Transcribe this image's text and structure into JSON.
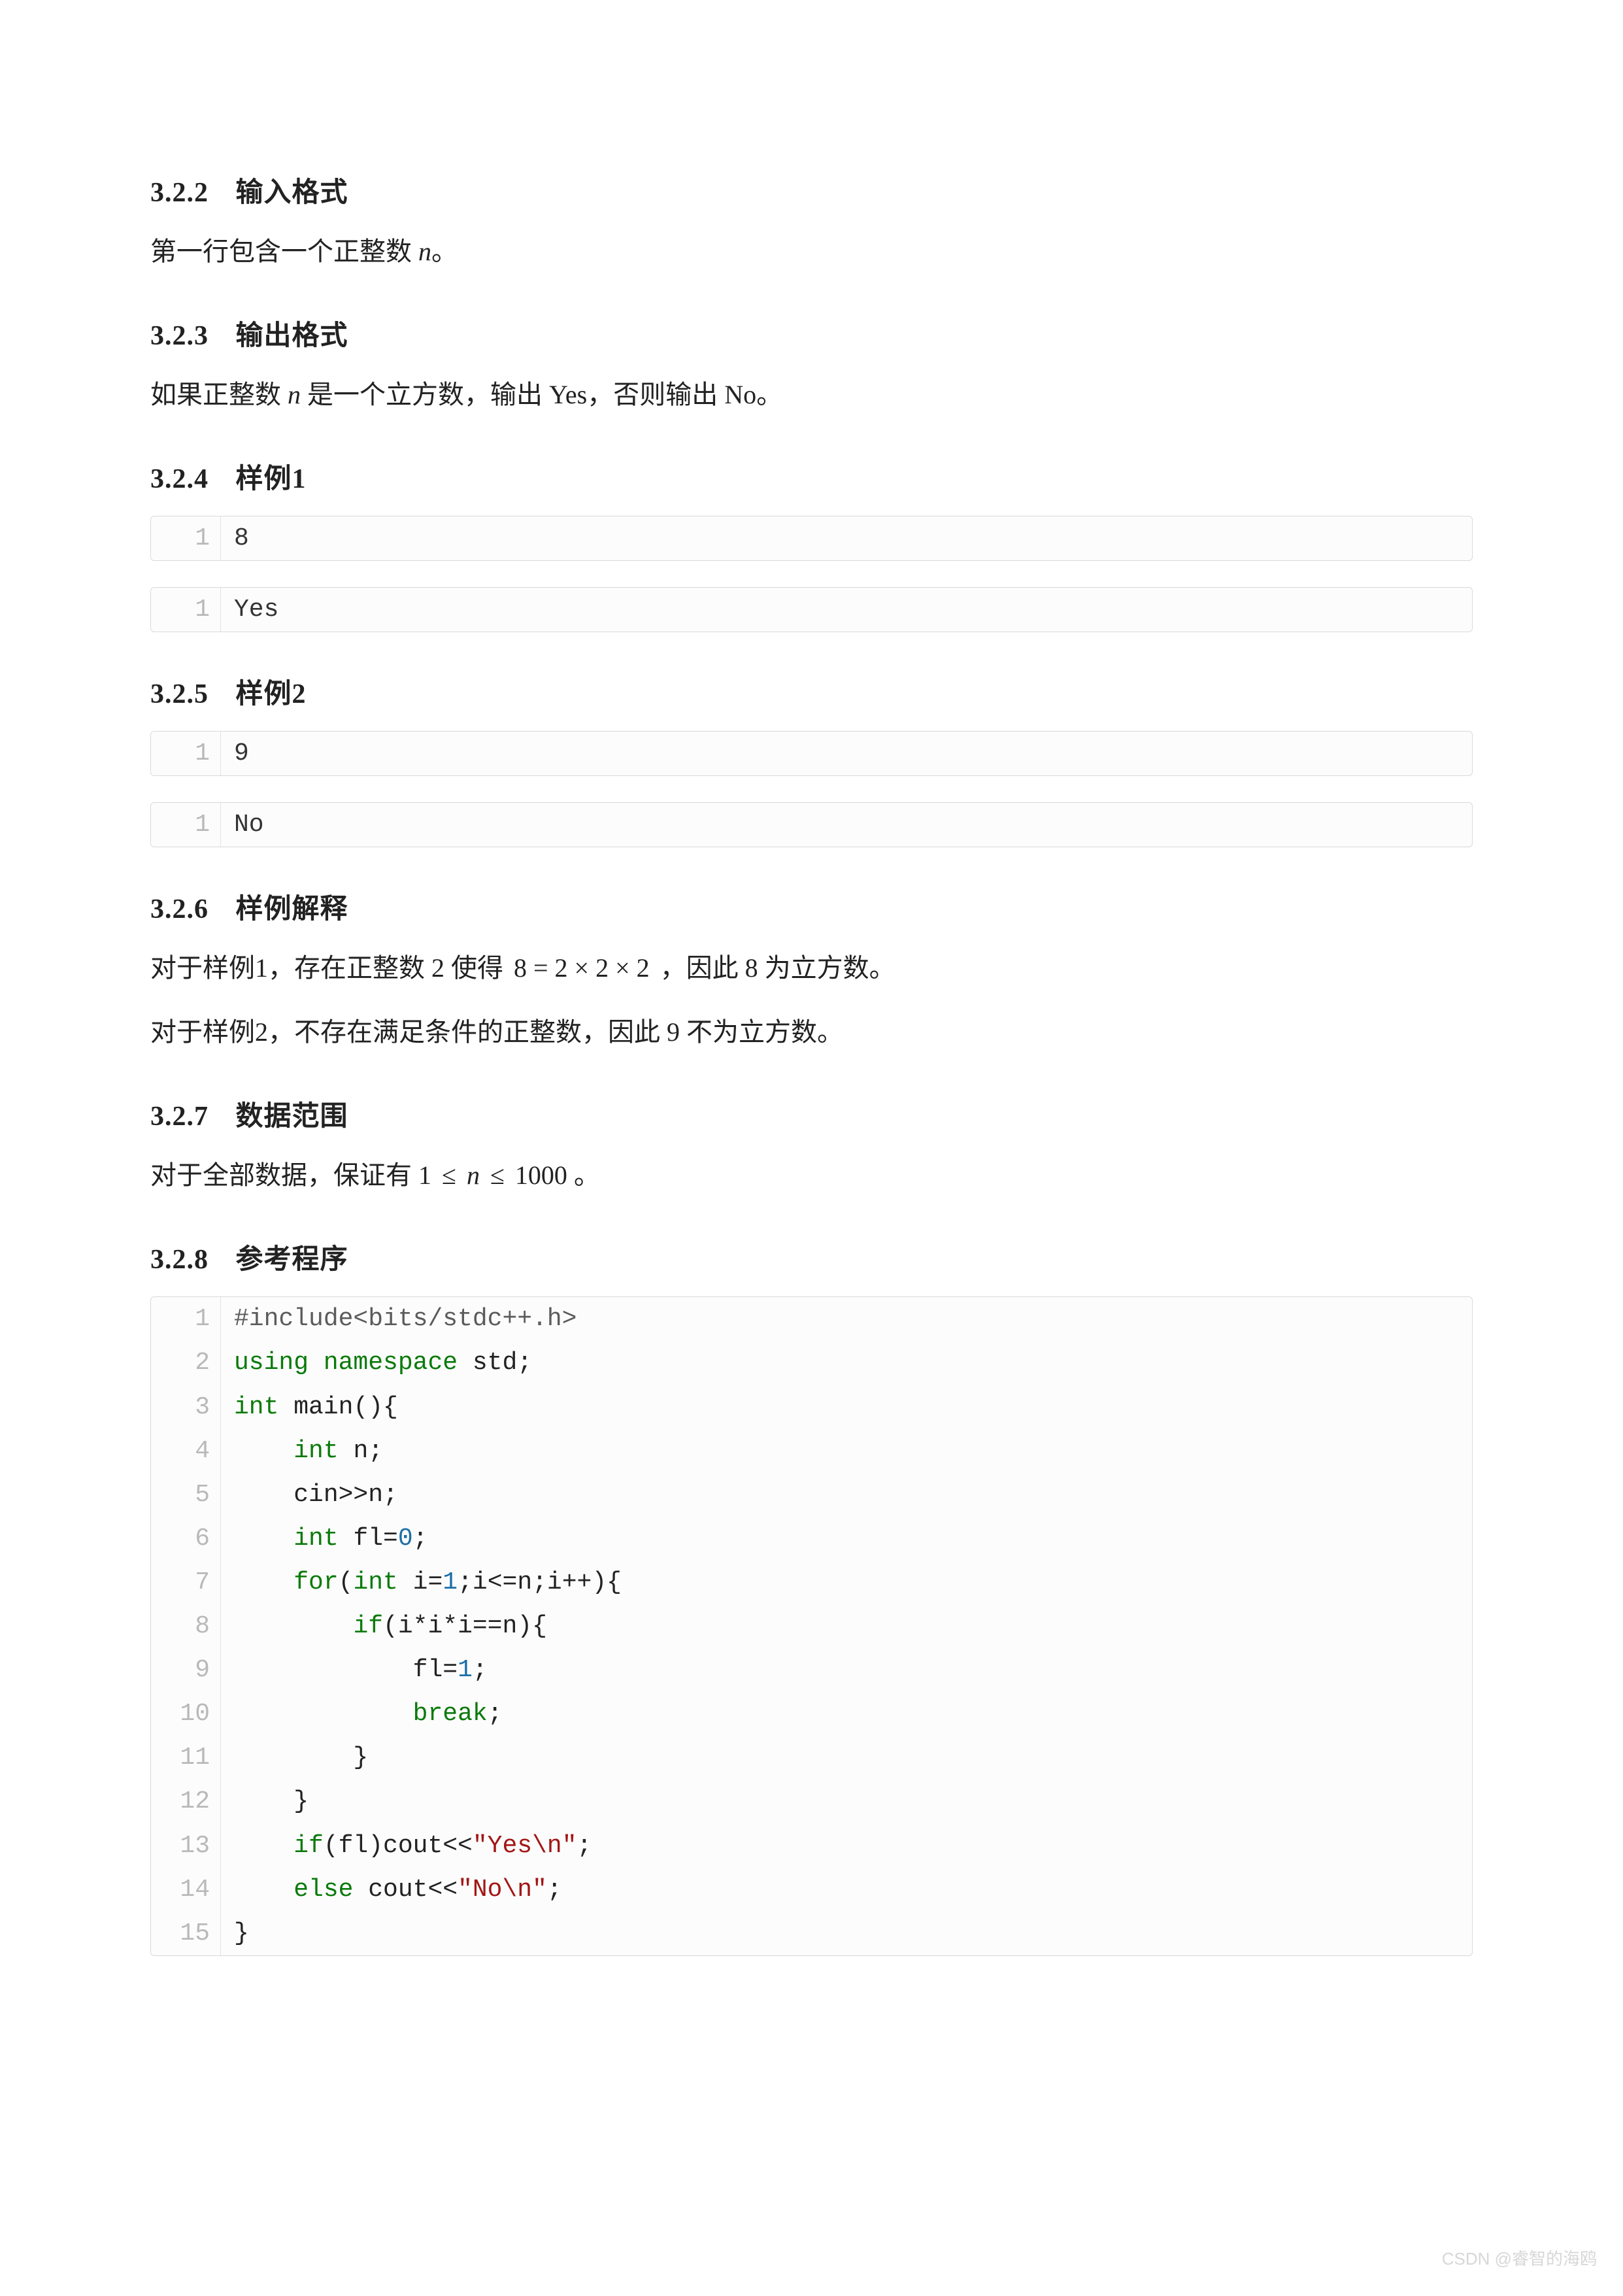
{
  "sections": {
    "s322": {
      "num": "3.2.2",
      "title": "输入格式",
      "body": "第一行包含一个正整数 n。"
    },
    "s323": {
      "num": "3.2.3",
      "title": "输出格式",
      "body": "如果正整数 n 是一个立方数，输出 Yes，否则输出 No。"
    },
    "s324": {
      "num": "3.2.4",
      "title": "样例1"
    },
    "s325": {
      "num": "3.2.5",
      "title": "样例2"
    },
    "s326": {
      "num": "3.2.6",
      "title": "样例解释",
      "line1_a": "对于样例1，存在正整数 2 使得 ",
      "line1_math": "8 = 2 × 2 × 2",
      "line1_b": "，因此 8 为立方数。",
      "line2": "对于样例2，不存在满足条件的正整数，因此 9 不为立方数。"
    },
    "s327": {
      "num": "3.2.7",
      "title": "数据范围",
      "body_a": "对于全部数据，保证有 ",
      "body_math": "1 ≤ n ≤ 1000",
      "body_b": "。"
    },
    "s328": {
      "num": "3.2.8",
      "title": "参考程序"
    }
  },
  "examples": {
    "ex1_in": [
      {
        "n": "1",
        "text": "8"
      }
    ],
    "ex1_out": [
      {
        "n": "1",
        "text": "Yes"
      }
    ],
    "ex2_in": [
      {
        "n": "1",
        "text": "9"
      }
    ],
    "ex2_out": [
      {
        "n": "1",
        "text": "No"
      }
    ]
  },
  "program": {
    "lines": [
      {
        "n": "1",
        "tokens": [
          {
            "t": "#include<bits/stdc++.h>",
            "c": "pp"
          }
        ]
      },
      {
        "n": "2",
        "tokens": [
          {
            "t": "using ",
            "c": "kw"
          },
          {
            "t": "namespace ",
            "c": "kw"
          },
          {
            "t": "std",
            "c": "id"
          },
          {
            "t": ";",
            "c": "op"
          }
        ]
      },
      {
        "n": "3",
        "tokens": [
          {
            "t": "int ",
            "c": "type"
          },
          {
            "t": "main",
            "c": "fn"
          },
          {
            "t": "(){",
            "c": "op"
          }
        ]
      },
      {
        "n": "4",
        "tokens": [
          {
            "t": "    ",
            "c": "id"
          },
          {
            "t": "int ",
            "c": "type"
          },
          {
            "t": "n",
            "c": "id"
          },
          {
            "t": ";",
            "c": "op"
          }
        ]
      },
      {
        "n": "5",
        "tokens": [
          {
            "t": "    cin>>n;",
            "c": "id"
          }
        ]
      },
      {
        "n": "6",
        "tokens": [
          {
            "t": "    ",
            "c": "id"
          },
          {
            "t": "int ",
            "c": "type"
          },
          {
            "t": "fl",
            "c": "id"
          },
          {
            "t": "=",
            "c": "op"
          },
          {
            "t": "0",
            "c": "num"
          },
          {
            "t": ";",
            "c": "op"
          }
        ]
      },
      {
        "n": "7",
        "tokens": [
          {
            "t": "    ",
            "c": "id"
          },
          {
            "t": "for",
            "c": "kw"
          },
          {
            "t": "(",
            "c": "op"
          },
          {
            "t": "int ",
            "c": "type"
          },
          {
            "t": "i",
            "c": "id"
          },
          {
            "t": "=",
            "c": "op"
          },
          {
            "t": "1",
            "c": "num"
          },
          {
            "t": ";i<=n;i++){",
            "c": "id"
          }
        ]
      },
      {
        "n": "8",
        "tokens": [
          {
            "t": "        ",
            "c": "id"
          },
          {
            "t": "if",
            "c": "kw"
          },
          {
            "t": "(i*i*i==n){",
            "c": "id"
          }
        ]
      },
      {
        "n": "9",
        "tokens": [
          {
            "t": "            fl=",
            "c": "id"
          },
          {
            "t": "1",
            "c": "num"
          },
          {
            "t": ";",
            "c": "op"
          }
        ]
      },
      {
        "n": "10",
        "tokens": [
          {
            "t": "            ",
            "c": "id"
          },
          {
            "t": "break",
            "c": "kw"
          },
          {
            "t": ";",
            "c": "op"
          }
        ]
      },
      {
        "n": "11",
        "tokens": [
          {
            "t": "        }",
            "c": "op"
          }
        ]
      },
      {
        "n": "12",
        "tokens": [
          {
            "t": "    }",
            "c": "op"
          }
        ]
      },
      {
        "n": "13",
        "tokens": [
          {
            "t": "    ",
            "c": "id"
          },
          {
            "t": "if",
            "c": "kw"
          },
          {
            "t": "(fl)cout<<",
            "c": "id"
          },
          {
            "t": "\"Yes\\n\"",
            "c": "str"
          },
          {
            "t": ";",
            "c": "op"
          }
        ]
      },
      {
        "n": "14",
        "tokens": [
          {
            "t": "    ",
            "c": "id"
          },
          {
            "t": "else ",
            "c": "kw"
          },
          {
            "t": "cout<<",
            "c": "id"
          },
          {
            "t": "\"No\\n\"",
            "c": "str"
          },
          {
            "t": ";",
            "c": "op"
          }
        ]
      },
      {
        "n": "15",
        "tokens": [
          {
            "t": "}",
            "c": "op"
          }
        ]
      }
    ]
  },
  "footer": "CSDN @睿智的海鸥"
}
